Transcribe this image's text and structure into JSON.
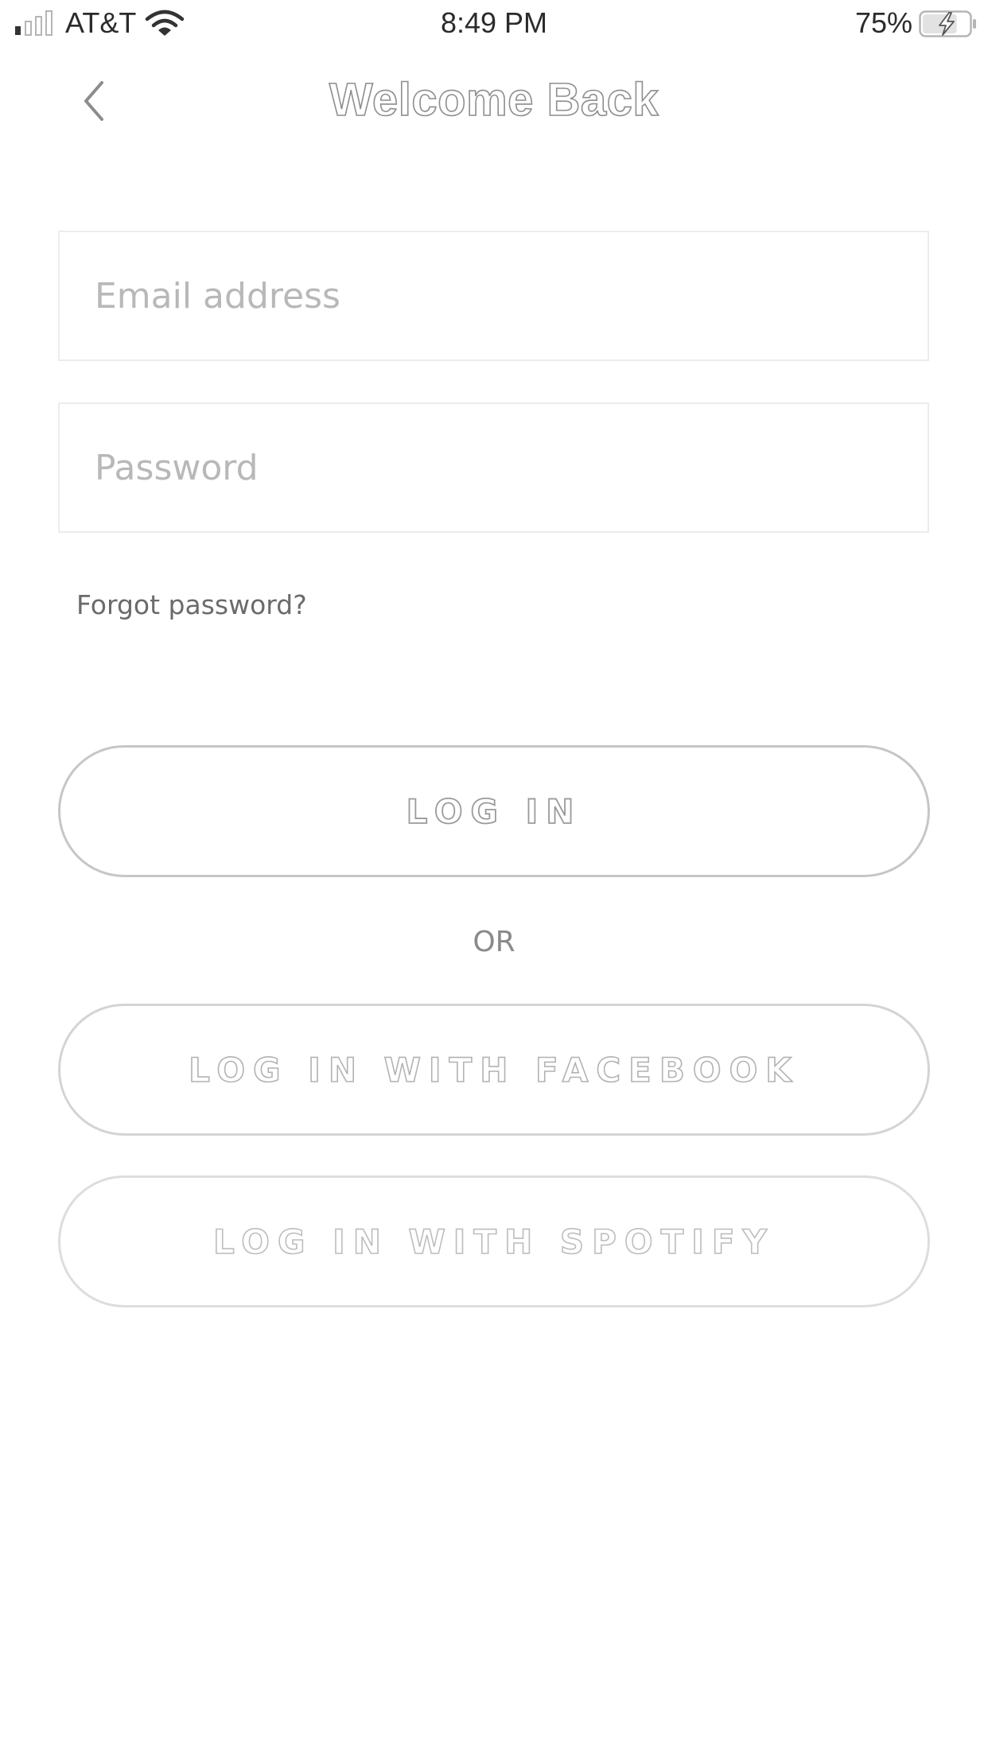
{
  "status_bar": {
    "carrier": "AT&T",
    "time": "8:49 PM",
    "battery_percent": "75%",
    "battery_level": 0.75,
    "charging": true,
    "signal_bars_active": 1,
    "signal_bars_total": 4
  },
  "header": {
    "back_icon": "chevron-left-icon",
    "title": "Welcome Back"
  },
  "form": {
    "email_placeholder": "Email address",
    "email_value": "",
    "password_placeholder": "Password",
    "password_value": "",
    "forgot_password": "Forgot password?"
  },
  "actions": {
    "login_label": "LOG IN",
    "divider_label": "OR",
    "facebook_label": "LOG IN WITH FACEBOOK",
    "spotify_label": "LOG IN WITH SPOTIFY"
  },
  "colors": {
    "background": "#ffffff",
    "field_border": "#ececec",
    "button_border": "#c6c6c6",
    "placeholder": "#b8b8b8",
    "secondary_text": "#6b6b6b"
  }
}
